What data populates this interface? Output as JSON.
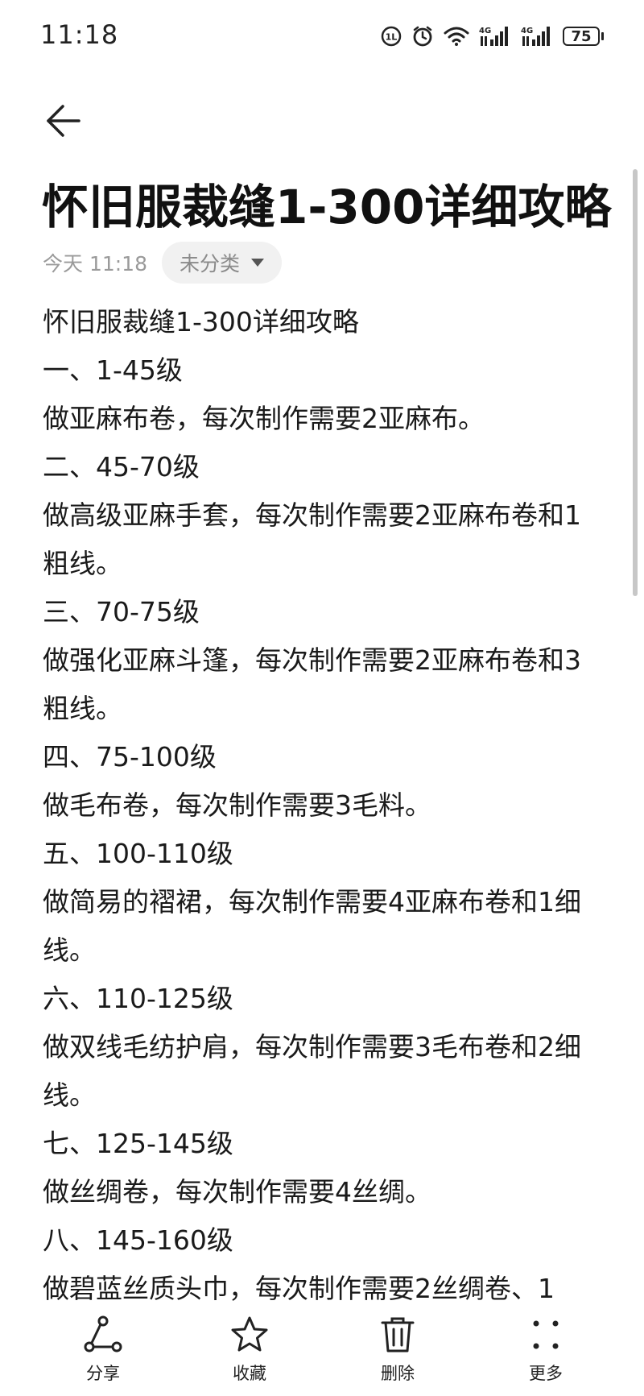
{
  "status_bar": {
    "time": "11:18",
    "icons": [
      "hd-call-icon",
      "alarm-icon",
      "wifi-icon",
      "signal-4g-icon",
      "signal-4g-icon"
    ],
    "network_label_1": "4G",
    "network_label_2": "4G",
    "battery": "75"
  },
  "header": {
    "back_icon": "back-arrow-icon",
    "title": "怀旧服裁缝1-300详细攻略"
  },
  "meta": {
    "date": "今天 11:18",
    "category": "未分类"
  },
  "body": {
    "lines": [
      "怀旧服裁缝1-300详细攻略",
      "一、1-45级",
      "做亚麻布卷，每次制作需要2亚麻布。",
      "二、45-70级",
      "做高级亚麻手套，每次制作需要2亚麻布卷和1粗线。",
      "三、70-75级",
      "做强化亚麻斗篷，每次制作需要2亚麻布卷和3粗线。",
      "四、75-100级",
      "做毛布卷，每次制作需要3毛料。",
      "五、100-110级",
      "做简易的褶裙，每次制作需要4亚麻布卷和1细线。",
      "六、110-125级",
      "做双线毛纺护肩，每次制作需要3毛布卷和2细线。",
      "七、125-145级",
      "做丝绸卷，每次制作需要4丝绸。",
      "八、145-160级",
      "做碧蓝丝质头巾，每次制作需要2丝绸卷、1"
    ]
  },
  "bottom_bar": {
    "items": [
      {
        "label": "分享",
        "icon": "share-icon"
      },
      {
        "label": "收藏",
        "icon": "star-icon"
      },
      {
        "label": "删除",
        "icon": "trash-icon"
      },
      {
        "label": "更多",
        "icon": "more-icon"
      }
    ]
  },
  "colors": {
    "text": "#1a1a1a",
    "meta_text": "#9a9a9a",
    "chip_bg": "#f1f1f1"
  }
}
